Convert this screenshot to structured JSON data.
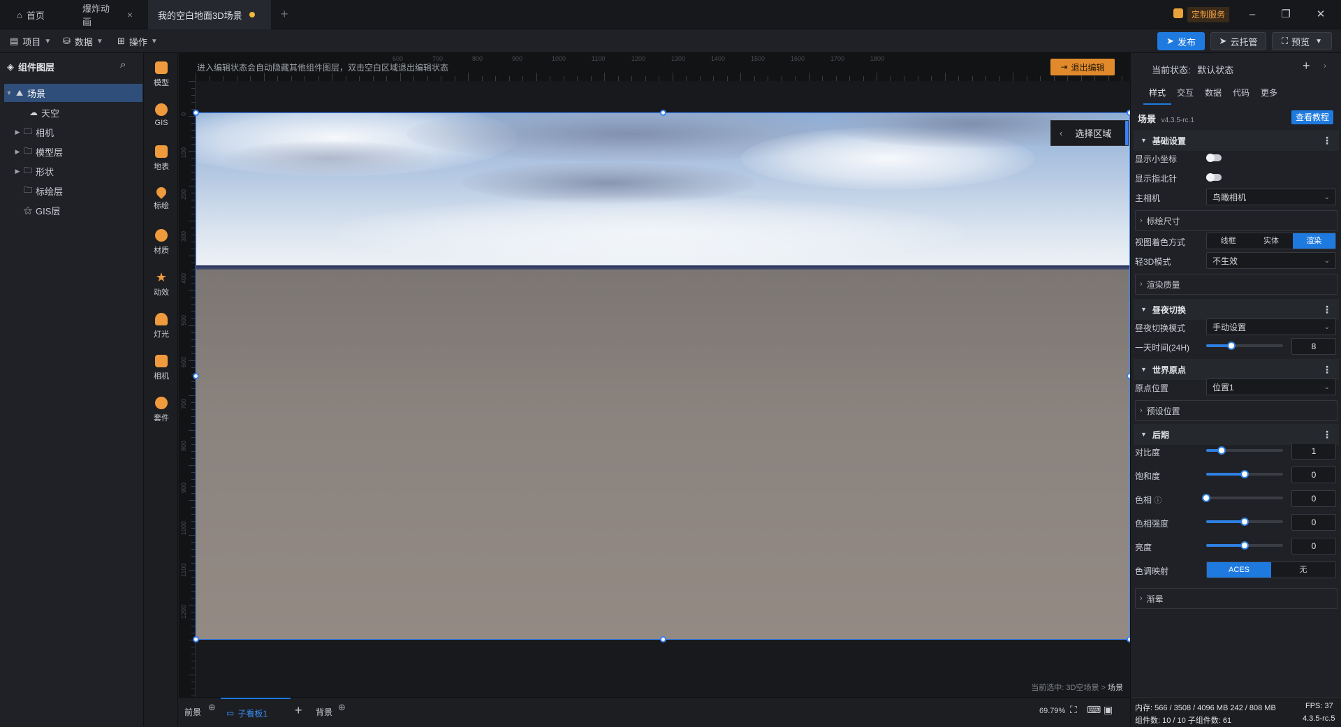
{
  "titlebar": {
    "tabs": [
      {
        "label": "首页"
      },
      {
        "label": "爆炸动画"
      },
      {
        "label": "我的空白地面3D场景"
      }
    ],
    "custom_service": "定制服务"
  },
  "menubar": {
    "project": "项目",
    "data": "数据",
    "operate": "操作",
    "publish": "发布",
    "cloud_host": "云托管",
    "preview": "预览"
  },
  "left_panel": {
    "title": "组件图层",
    "tree": [
      {
        "label": "场景"
      },
      {
        "label": "天空"
      },
      {
        "label": "相机"
      },
      {
        "label": "模型层"
      },
      {
        "label": "形状"
      },
      {
        "label": "标绘层"
      },
      {
        "label": "GIS层"
      }
    ]
  },
  "toolbox": {
    "items": [
      {
        "label": "模型",
        "color": "#f09a3e"
      },
      {
        "label": "GIS",
        "color": "#f09a3e"
      },
      {
        "label": "地表",
        "color": "#f09a3e"
      },
      {
        "label": "标绘",
        "color": "#f09a3e"
      },
      {
        "label": "材质",
        "color": "#f09a3e"
      },
      {
        "label": "动效",
        "color": "#f09a3e"
      },
      {
        "label": "灯光",
        "color": "#f09a3e"
      },
      {
        "label": "相机",
        "color": "#f09a3e"
      },
      {
        "label": "套件",
        "color": "#f09a3e"
      }
    ]
  },
  "canvas": {
    "hint": "进入编辑状态会自动隐藏其他组件图层，双击空白区域退出编辑状态",
    "exit_edit": "退出编辑",
    "ruler_top": [
      "600",
      "700",
      "800",
      "900",
      "1000",
      "1100",
      "1200",
      "1300",
      "1400",
      "1500",
      "1600",
      "1700",
      "1800"
    ],
    "ruler_left": [
      "0",
      "100",
      "200",
      "300",
      "400",
      "500",
      "600",
      "700",
      "800",
      "900",
      "1000",
      "1100",
      "1200"
    ],
    "select_region": "选择区域",
    "breadcrumb_prefix": "当前选中: 3D空场景 >",
    "breadcrumb_current": "场景"
  },
  "bottombar": {
    "foreground": "前景",
    "board": "子看板1",
    "background": "背景",
    "zoom": "69.79%"
  },
  "right_panel": {
    "state_label": "当前状态:",
    "state_value": "默认状态",
    "tabs": [
      "样式",
      "交互",
      "数据",
      "代码",
      "更多"
    ],
    "scene_title": "场景",
    "version": "v4.3.5-rc.1",
    "tutorial": "查看教程",
    "basic_section": "基础设置",
    "show_axis": "显示小坐标",
    "show_compass": "显示指北针",
    "main_camera_label": "主相机",
    "main_camera_value": "鸟瞰相机",
    "marker_size": "标绘尺寸",
    "color_mode_label": "视图着色方式",
    "color_modes": [
      "线框",
      "实体",
      "渲染"
    ],
    "light3d_label": "轻3D模式",
    "light3d_value": "不生效",
    "render_quality": "渲染质量",
    "daynight_section": "昼夜切换",
    "daynight_mode_label": "昼夜切换模式",
    "daynight_mode_value": "手动设置",
    "daytime_label": "一天时间(24H)",
    "daytime_value": "8",
    "daytime_fraction": 0.33,
    "world_section": "世界原点",
    "origin_label": "原点位置",
    "origin_value": "位置1",
    "preset_position": "预设位置",
    "post_section": "后期",
    "contrast_label": "对比度",
    "contrast_value": "1",
    "contrast_fraction": 0.2,
    "saturation_label": "饱和度",
    "saturation_value": "0",
    "saturation_fraction": 0.5,
    "hue_label": "色相",
    "hue_value": "0",
    "hue_fraction": 0.0,
    "hue_intensity_label": "色相强度",
    "hue_intensity_value": "0",
    "hue_intensity_fraction": 0.5,
    "brightness_label": "亮度",
    "brightness_value": "0",
    "brightness_fraction": 0.5,
    "tonemap_label": "色调映射",
    "tonemap_options": [
      "ACES",
      "无"
    ],
    "vignette": "渐晕"
  },
  "status": {
    "memory": "内存:  566 / 3508 / 4096 MB  242 / 808 MB",
    "fps": "FPS:  37",
    "components": "组件数: 10 / 10   子组件数: 61",
    "version": "4.3.5-rc.5"
  },
  "colors": {
    "accent": "#3b82f6",
    "exit_button": "#e08a2c",
    "selected_tree": "#2f4e7a"
  }
}
